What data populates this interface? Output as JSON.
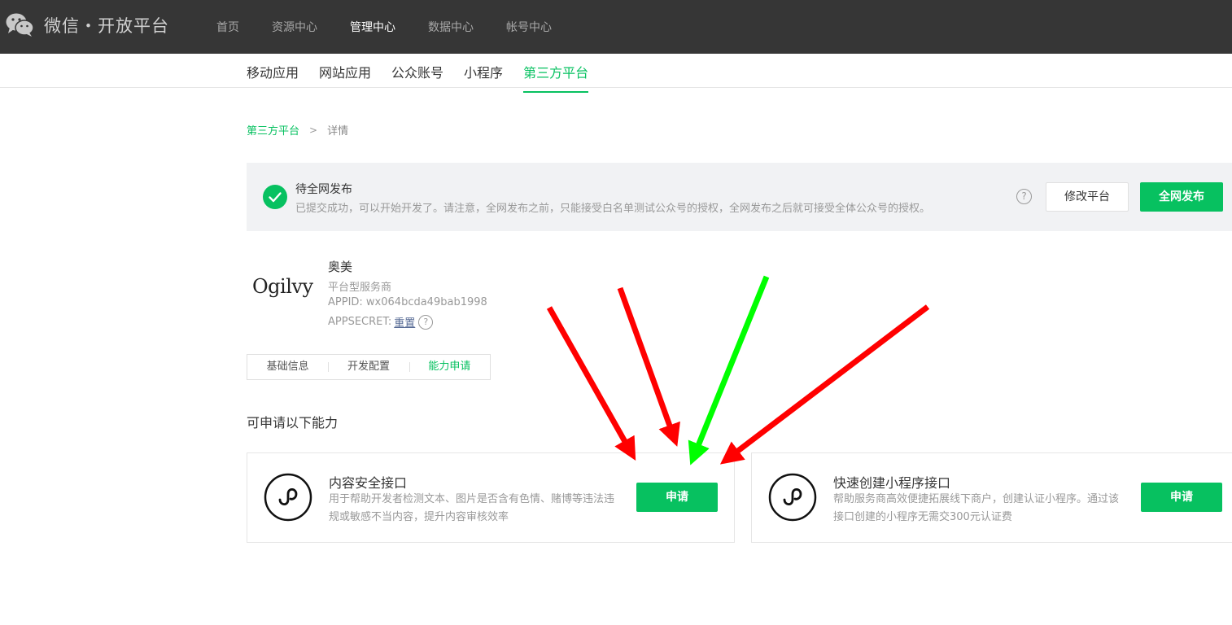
{
  "header": {
    "brand": "微信・开放平台",
    "nav": [
      "首页",
      "资源中心",
      "管理中心",
      "数据中心",
      "帐号中心"
    ]
  },
  "subnav": [
    "移动应用",
    "网站应用",
    "公众账号",
    "小程序",
    "第三方平台"
  ],
  "breadcrumb": {
    "parent": "第三方平台",
    "separator": ">",
    "current": "详情"
  },
  "notice": {
    "title": "待全网发布",
    "desc": "已提交成功，可以开始开发了。请注意，全网发布之前，只能接受白名单测试公众号的授权，全网发布之后就可接受全体公众号的授权。",
    "help": "?",
    "modify_button": "修改平台",
    "publish_button": "全网发布"
  },
  "profile": {
    "logo_text": "Ogilvy",
    "name": "奥美",
    "type": "平台型服务商",
    "appid": "APPID: wx064bcda49bab1998",
    "appsecret_label": "APPSECRET:",
    "reset_link": "重置",
    "help": "?"
  },
  "tabs": [
    "基础信息",
    "开发配置",
    "能力申请"
  ],
  "section_title": "可申请以下能力",
  "cards": [
    {
      "title": "内容安全接口",
      "desc": "用于帮助开发者检测文本、图片是否含有色情、赌博等违法违规或敏感不当内容，提升内容审核效率",
      "button": "申请"
    },
    {
      "title": "快速创建小程序接口",
      "desc": "帮助服务商高效便捷拓展线下商户，创建认证小程序。通过该接口创建的小程序无需交300元认证费",
      "button": "申请"
    }
  ],
  "colors": {
    "topbar": "#363636",
    "accent": "#07c160",
    "arrow_red": "#ff0000",
    "arrow_green": "#00ff00"
  }
}
